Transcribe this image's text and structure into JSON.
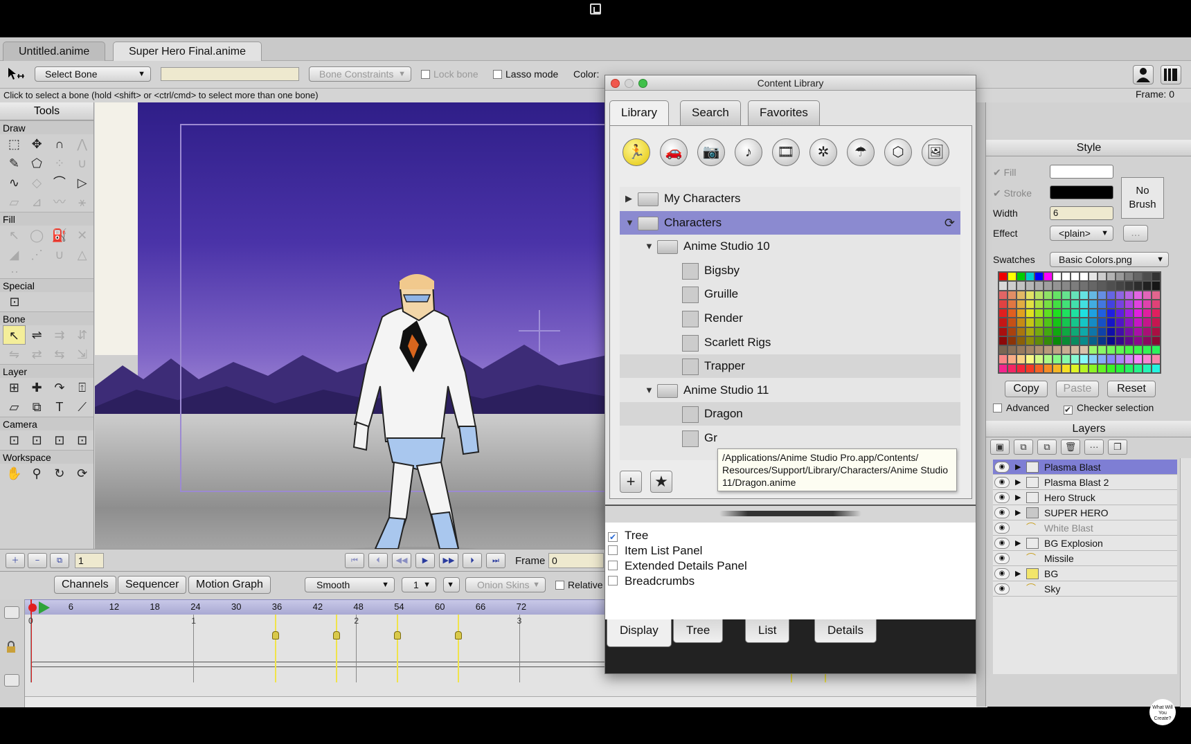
{
  "doc_tabs": [
    "Untitled.anime",
    "Super Hero Final.anime"
  ],
  "toolbar": {
    "tool_select": "Select Bone",
    "bone_constraints": "Bone Constraints",
    "lock_bone": "Lock bone",
    "lasso_mode": "Lasso mode",
    "color_label": "Color:",
    "frame_readout": "Frame: 0"
  },
  "hint": "Click to select a bone (hold <shift> or <ctrl/cmd> to select more than one bone)",
  "tools": {
    "title": "Tools",
    "sections": [
      "Draw",
      "Fill",
      "Special",
      "Bone",
      "Layer",
      "Camera",
      "Workspace"
    ]
  },
  "playback": {
    "layer_field": "1",
    "frame_label": "Frame",
    "frame_value": "0"
  },
  "timeline": {
    "tabs": [
      "Channels",
      "Sequencer",
      "Motion Graph"
    ],
    "interpolation": "Smooth",
    "step": "1",
    "onion_skins": "Onion Skins",
    "relative": "Relative",
    "ruler_ticks": [
      "6",
      "12",
      "18",
      "24",
      "30",
      "36",
      "42",
      "48",
      "54",
      "60",
      "66",
      "72"
    ],
    "second_labels": [
      "0",
      "1",
      "2",
      "3"
    ],
    "keyframes": [
      36,
      45,
      54,
      63,
      112,
      117
    ]
  },
  "library": {
    "title": "Content Library",
    "tabs": [
      "Library",
      "Search",
      "Favorites"
    ],
    "category_icons": [
      "running-figure-icon",
      "car-icon",
      "camera-icon",
      "music-note-icon",
      "film-icon",
      "particles-icon",
      "umbrella-icon",
      "cube-icon",
      "image-icon"
    ],
    "tree": [
      {
        "label": "My Characters",
        "level": 0,
        "type": "folder",
        "expanded": false
      },
      {
        "label": "Characters",
        "level": 0,
        "type": "folder",
        "expanded": true,
        "selected": true
      },
      {
        "label": "Anime Studio 10",
        "level": 1,
        "type": "folder",
        "expanded": true
      },
      {
        "label": "Bigsby",
        "level": 2,
        "type": "item"
      },
      {
        "label": "Gruille",
        "level": 2,
        "type": "item"
      },
      {
        "label": "Render",
        "level": 2,
        "type": "item"
      },
      {
        "label": "Scarlett Rigs",
        "level": 2,
        "type": "item"
      },
      {
        "label": "Trapper",
        "level": 2,
        "type": "item"
      },
      {
        "label": "Anime Studio 11",
        "level": 1,
        "type": "folder",
        "expanded": true
      },
      {
        "label": "Dragon",
        "level": 2,
        "type": "item"
      },
      {
        "label": "Gr",
        "level": 2,
        "type": "item"
      }
    ],
    "tooltip": "/Applications/Anime Studio Pro.app/Contents/ Resources/Support/Library/Characters/Anime Studio 11/Dragon.anime",
    "display_options": [
      {
        "label": "Tree",
        "checked": true
      },
      {
        "label": "Item List Panel",
        "checked": false
      },
      {
        "label": "Extended Details Panel",
        "checked": false
      },
      {
        "label": "Breadcrumbs",
        "checked": false
      }
    ],
    "bottom_tabs": [
      "Display",
      "Tree",
      "List",
      "Details"
    ]
  },
  "style": {
    "title": "Style",
    "fill_label": "Fill",
    "stroke_label": "Stroke",
    "width_label": "Width",
    "width_value": "6",
    "effect_label": "Effect",
    "effect_value": "<plain>",
    "effect_more": "...",
    "no_brush": "No Brush",
    "swatches_label": "Swatches",
    "swatches_value": "Basic Colors.png",
    "copy": "Copy",
    "paste": "Paste",
    "reset": "Reset",
    "advanced": "Advanced",
    "checker": "Checker selection",
    "fill_color": "#ffffff",
    "stroke_color": "#000000"
  },
  "layers": {
    "title": "Layers",
    "items": [
      {
        "name": "Plasma Blast",
        "kind": "group",
        "selected": true,
        "dim": false
      },
      {
        "name": "Plasma Blast 2",
        "kind": "group",
        "selected": false,
        "dim": false
      },
      {
        "name": "Hero Struck",
        "kind": "group",
        "selected": false,
        "dim": false
      },
      {
        "name": "SUPER HERO",
        "kind": "bone",
        "selected": false,
        "dim": false
      },
      {
        "name": "White Blast",
        "kind": "vector",
        "selected": false,
        "dim": true
      },
      {
        "name": "BG Explosion",
        "kind": "group",
        "selected": false,
        "dim": false
      },
      {
        "name": "Missile",
        "kind": "vector",
        "selected": false,
        "dim": false
      },
      {
        "name": "BG",
        "kind": "folder",
        "selected": false,
        "dim": false
      },
      {
        "name": "Sky",
        "kind": "vector",
        "selected": false,
        "dim": false
      }
    ]
  },
  "watermark": "What Will You Create?"
}
